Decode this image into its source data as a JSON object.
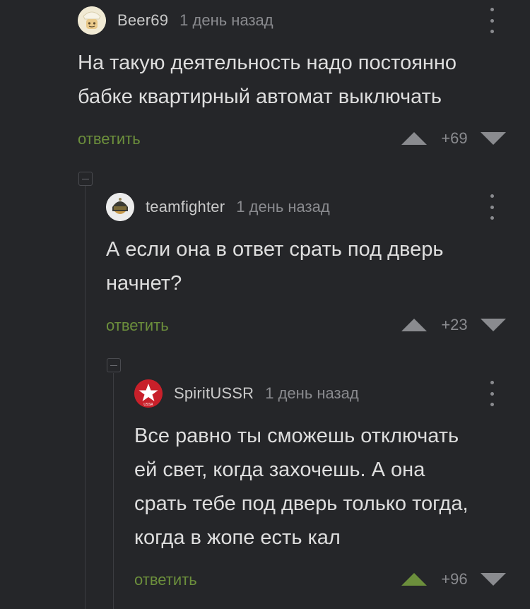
{
  "comments": [
    {
      "author": "Beer69",
      "time": "1 день назад",
      "avatar_icon": "cartoon-face-avatar",
      "lines": [
        "На такую деятельность надо постоянно",
        "бабке квартирный автомат выключать"
      ],
      "reply_label": "ответить",
      "score": "+69",
      "upvoted": false
    },
    {
      "author": "teamfighter",
      "time": "1 день назад",
      "avatar_icon": "helmet-avatar",
      "lines": [
        "А если она в ответ срать под дверь",
        "начнет?"
      ],
      "reply_label": "ответить",
      "score": "+23",
      "upvoted": false
    },
    {
      "author": "SpiritUSSR",
      "time": "1 день назад",
      "avatar_icon": "red-star-avatar",
      "avatar_text": "USSR",
      "lines": [
        "Все равно ты сможешь отключать",
        "ей свет, когда захочешь. А она",
        "срать тебе под дверь только тогда,",
        "когда в жопе есть кал"
      ],
      "reply_label": "ответить",
      "score": "+96",
      "upvoted": true
    }
  ],
  "colors": {
    "background": "#252629",
    "reply_link": "#6c8f3c",
    "upvote_active": "#6c8f3c",
    "muted": "#8a8b8f"
  }
}
